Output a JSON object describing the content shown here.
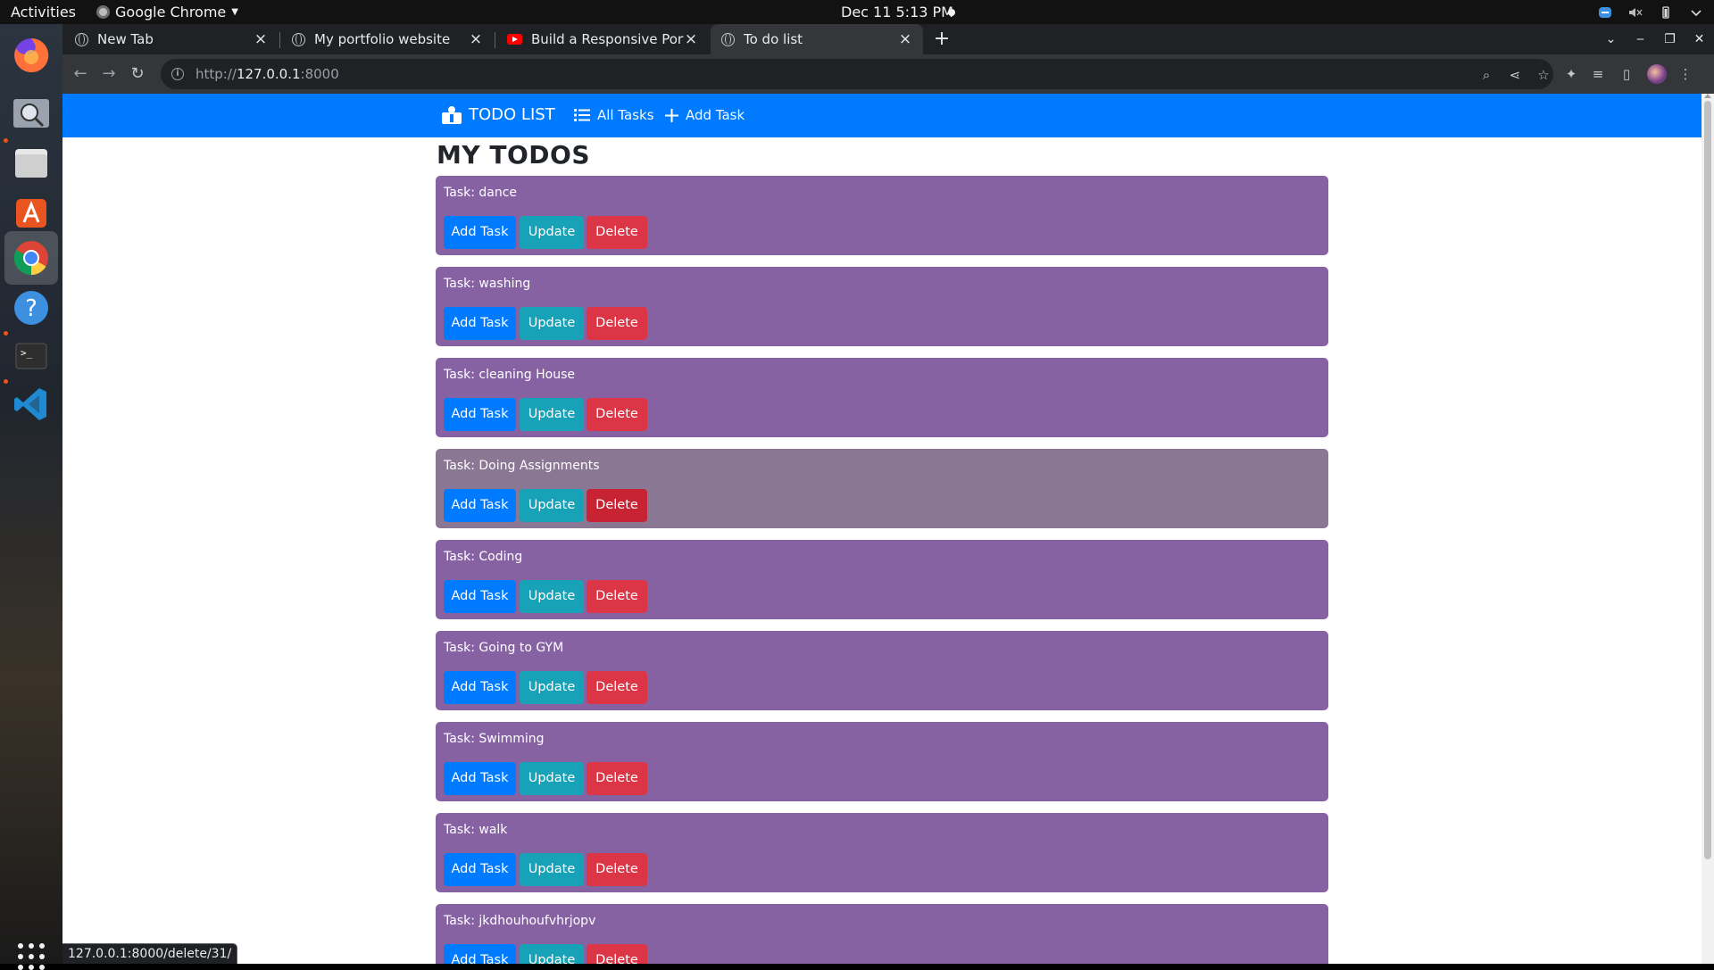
{
  "system": {
    "activities": "Activities",
    "app_name": "Google Chrome",
    "clock": "Dec 11   5:13 PM"
  },
  "dock": {
    "apps": [
      "Firefox",
      "Search",
      "Files",
      "Ubuntu Software",
      "Google Chrome",
      "Help",
      "Terminal",
      "Visual Studio Code"
    ]
  },
  "browser": {
    "tabs": [
      {
        "title": "New Tab",
        "favicon": "globe-icon"
      },
      {
        "title": "My portfolio website",
        "favicon": "globe-icon"
      },
      {
        "title": "Build a Responsive Portfo",
        "favicon": "youtube-icon"
      },
      {
        "title": "To do list",
        "favicon": "globe-icon"
      }
    ],
    "url_prefix": "http://",
    "url_host": "127.0.0.1",
    "url_port": ":8000",
    "status_url": "127.0.0.1:8000/delete/31/"
  },
  "site": {
    "brand": "TODO LIST",
    "nav": {
      "all_tasks": "All Tasks",
      "add_task": "Add Task"
    },
    "page_title": "MY TODOS",
    "button_labels": {
      "add": "Add Task",
      "update": "Update",
      "delete": "Delete"
    },
    "todos": [
      "Task: dance",
      "Task: washing",
      "Task: cleaning House",
      "Task: Doing Assignments",
      "Task: Coding",
      "Task: Going to GYM",
      "Task: Swimming",
      "Task: walk",
      "Task: jkdhouhoufvhrjopv"
    ],
    "colors": {
      "navbar": "#007bff",
      "card": "#8662a3",
      "card_hover": "#8a7794",
      "btn_primary": "#007bff",
      "btn_info": "#17a2b8",
      "btn_danger": "#dc3545"
    }
  }
}
